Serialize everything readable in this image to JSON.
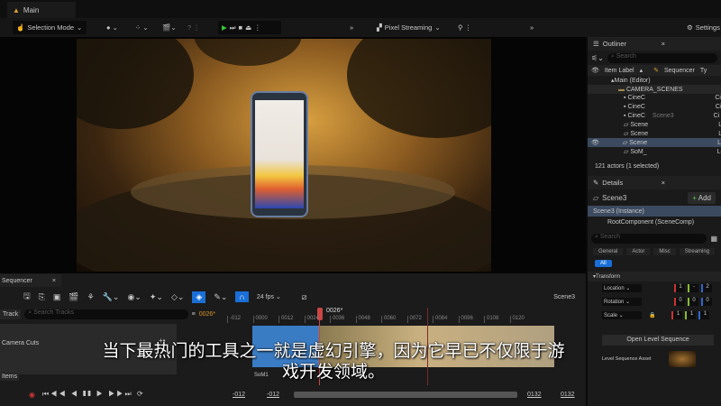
{
  "window": {
    "tab": "Main"
  },
  "toolbar": {
    "selection_mode": "Selection Mode",
    "pixel_streaming": "Pixel Streaming",
    "settings": "Settings"
  },
  "outliner": {
    "title": "Outliner",
    "search_placeholder": "Search",
    "col_label": "Item Label",
    "col_sequencer": "Sequencer",
    "col_type": "Ty",
    "items": [
      {
        "label": "Main (Editor)",
        "seq": "",
        "type": ""
      },
      {
        "label": "CAMERA_SCENES",
        "seq": "",
        "type": ""
      },
      {
        "label": "CineC",
        "seq": "",
        "type": "Ci"
      },
      {
        "label": "CineC",
        "seq": "",
        "type": "Ci"
      },
      {
        "label": "CineC",
        "seq": "Scene3",
        "type": "Ci"
      },
      {
        "label": "Scene",
        "seq": "",
        "type": "Le"
      },
      {
        "label": "Scene",
        "seq": "",
        "type": "Le"
      },
      {
        "label": "Scene",
        "seq": "",
        "type": "Le",
        "selected": true
      },
      {
        "label": "SoM_",
        "seq": "",
        "type": "Le"
      }
    ],
    "status": "121 actors (1 selected)"
  },
  "details": {
    "title": "Details",
    "actor": "Scene3",
    "add": "Add",
    "instance": "Scene3 (Instance)",
    "root": "RootComponent (SceneComp)",
    "search_placeholder": "Search",
    "filters": [
      "General",
      "Actor",
      "Misc",
      "Streaming"
    ],
    "all": "All",
    "transform": "Transform",
    "location": "Location",
    "rotation": "Rotation",
    "scale": "Scale",
    "loc_values": [
      "1",
      "-",
      "2"
    ],
    "rot_values": [
      "0",
      "0",
      "0"
    ],
    "scale_values": [
      "1",
      "1",
      "1"
    ],
    "open_seq": "Open Level Sequence",
    "asset_label": "Level Sequence Asset"
  },
  "sequencer": {
    "title": "Sequencer",
    "fps": "24 fps",
    "scene": "Scene3",
    "track": "Track",
    "search_placeholder": "Search Tracks",
    "current_frame": "0026*",
    "playhead": "0026*",
    "camera_cuts": "Camera Cuts",
    "items": "Items",
    "clip": "SoM1",
    "ticks": [
      "-012",
      "0000",
      "0012",
      "0024",
      "0036",
      "0048",
      "0060",
      "0072",
      "0084",
      "0096",
      "0108",
      "0120"
    ],
    "range_start": "-012",
    "range_start2": "-012",
    "range_end": "0132",
    "range_end2": "0132"
  },
  "subtitle": {
    "line1": "当下最热门的工具之一就是虚幻引擎，因为它早已不仅限于游",
    "line2": "戏开发领域。"
  }
}
